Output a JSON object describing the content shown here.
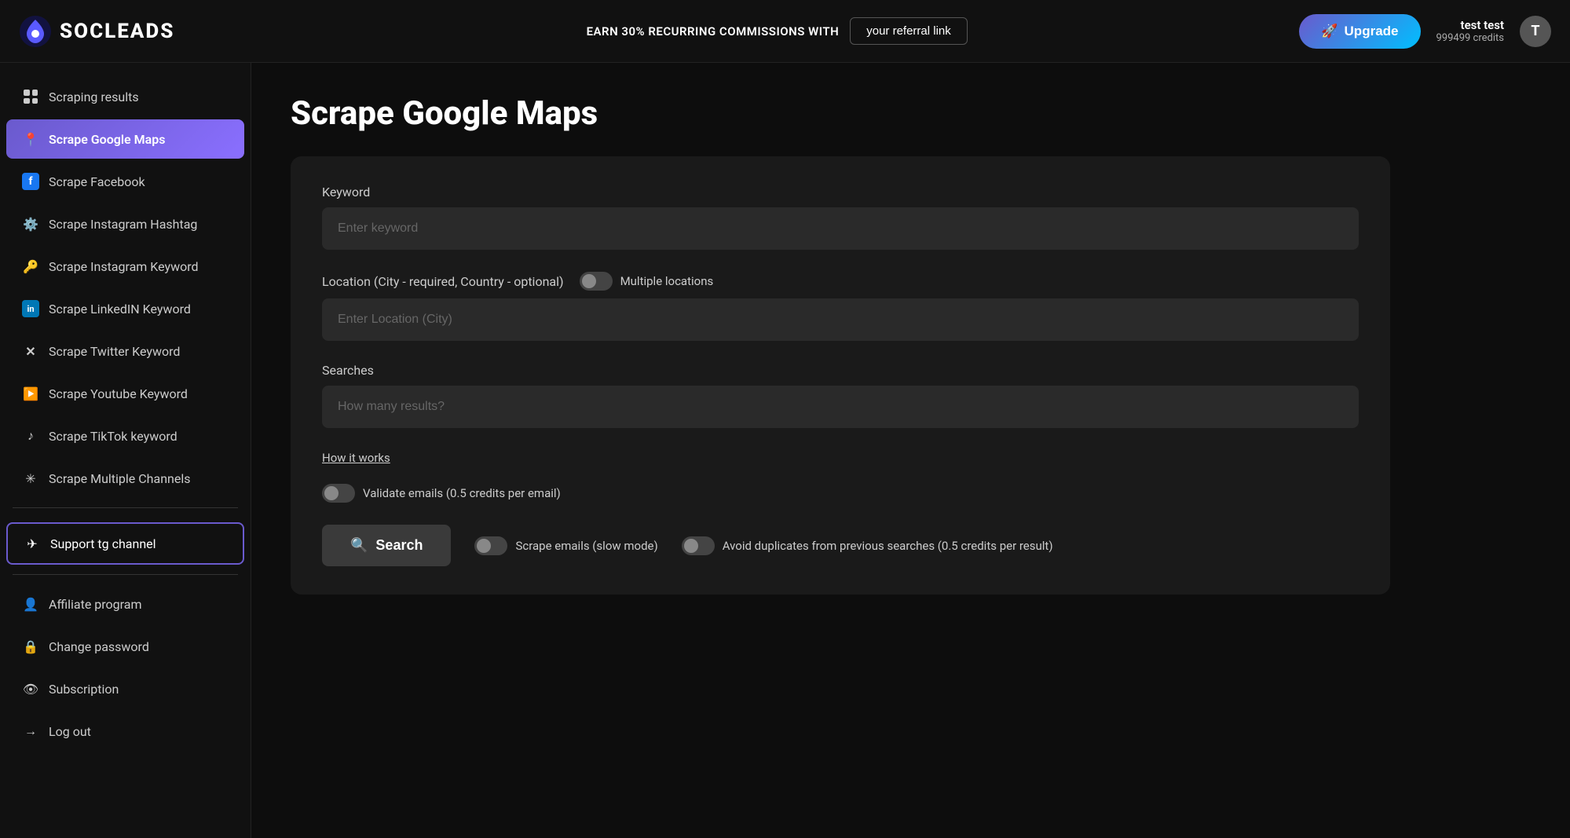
{
  "header": {
    "logo_text": "SOCLEADS",
    "earn_text": "EARN 30% RECURRING COMMISSIONS WITH",
    "referral_label": "your referral link",
    "upgrade_label": "Upgrade",
    "user_name": "test test",
    "user_credits": "999499 credits"
  },
  "sidebar": {
    "items": [
      {
        "id": "scraping-results",
        "label": "Scraping results",
        "icon": "grid"
      },
      {
        "id": "scrape-google-maps",
        "label": "Scrape Google Maps",
        "icon": "pin",
        "active": true
      },
      {
        "id": "scrape-facebook",
        "label": "Scrape Facebook",
        "icon": "F"
      },
      {
        "id": "scrape-instagram-hashtag",
        "label": "Scrape Instagram Hashtag",
        "icon": "hashtag"
      },
      {
        "id": "scrape-instagram-keyword",
        "label": "Scrape Instagram Keyword",
        "icon": "key"
      },
      {
        "id": "scrape-linkedin-keyword",
        "label": "Scrape LinkedIN Keyword",
        "icon": "in"
      },
      {
        "id": "scrape-twitter-keyword",
        "label": "Scrape Twitter Keyword",
        "icon": "X"
      },
      {
        "id": "scrape-youtube-keyword",
        "label": "Scrape Youtube Keyword",
        "icon": "yt"
      },
      {
        "id": "scrape-tiktok-keyword",
        "label": "Scrape TikTok keyword",
        "icon": "tiktok"
      },
      {
        "id": "scrape-multiple-channels",
        "label": "Scrape Multiple Channels",
        "icon": "asterisk"
      }
    ],
    "support_item": {
      "label": "Support tg channel",
      "icon": "telegram"
    },
    "bottom_items": [
      {
        "id": "affiliate-program",
        "label": "Affiliate program",
        "icon": "affiliate"
      },
      {
        "id": "change-password",
        "label": "Change password",
        "icon": "lock"
      },
      {
        "id": "subscription",
        "label": "Subscription",
        "icon": "subscription"
      },
      {
        "id": "log-out",
        "label": "Log out",
        "icon": "logout"
      }
    ]
  },
  "page": {
    "title": "Scrape Google Maps",
    "form": {
      "keyword_label": "Keyword",
      "keyword_placeholder": "Enter keyword",
      "location_label": "Location (City - required, Country - optional)",
      "multiple_locations_label": "Multiple locations",
      "location_placeholder": "Enter Location (City)",
      "searches_label": "Searches",
      "searches_placeholder": "How many results?",
      "how_it_works_label": "How it works",
      "validate_label": "Validate emails (0.5 credits per email)",
      "search_button_label": "Search",
      "scrape_emails_label": "Scrape emails (slow mode)",
      "avoid_duplicates_label": "Avoid duplicates from previous searches (0.5 credits per result)"
    }
  }
}
